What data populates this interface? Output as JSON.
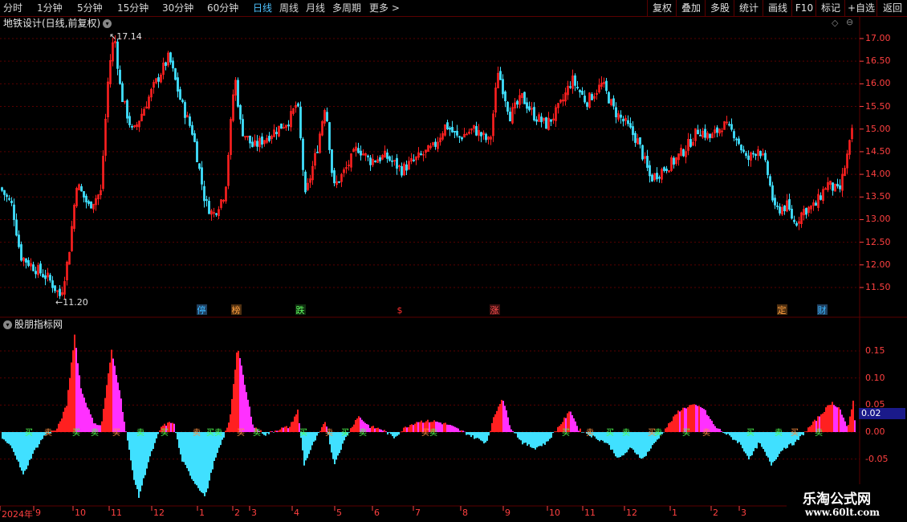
{
  "toolbar": {
    "left_items": [
      "分时",
      "1分钟",
      "5分钟",
      "15分钟",
      "30分钟",
      "60分钟",
      "日线",
      "周线",
      "月线",
      "多周期",
      "更多 >"
    ],
    "active_item": "日线",
    "right_items": [
      "复权",
      "叠加",
      "多股",
      "统计",
      "画线",
      "F10",
      "标记",
      "+自选",
      "返回"
    ]
  },
  "main_panel": {
    "title": "地铁设计(日线,前复权)",
    "high_label": "17.14",
    "low_label": "11.20",
    "price_axis": [
      "17.00",
      "16.50",
      "16.00",
      "15.50",
      "15.00",
      "14.50",
      "14.00",
      "13.50",
      "13.00",
      "12.50",
      "12.00",
      "11.50"
    ],
    "event_markers": [
      {
        "text": "停",
        "color": "#3cb8ff",
        "bg": "#204060"
      },
      {
        "text": "榜",
        "color": "#ffa040",
        "bg": "#503010"
      },
      {
        "text": "跌",
        "color": "#60ff60",
        "bg": "#103010"
      },
      {
        "text": "$",
        "color": "#ff3030",
        "bg": "#000000"
      },
      {
        "text": "涨",
        "color": "#ff5050",
        "bg": "#401010"
      },
      {
        "text": "定",
        "color": "#ffa040",
        "bg": "#503010"
      },
      {
        "text": "财",
        "color": "#3cb8ff",
        "bg": "#204060"
      }
    ]
  },
  "indicator_panel": {
    "title": "股朋指标网",
    "axis": [
      "0.15",
      "0.10",
      "0.05",
      "0.00",
      "-0.05"
    ],
    "current_value": "0.02",
    "signal_buy": "买",
    "signal_sell": "卖"
  },
  "date_axis": [
    "2024年",
    "9",
    "10",
    "11",
    "12",
    "1",
    "2",
    "3",
    "4",
    "5",
    "6",
    "7",
    "8",
    "9",
    "10",
    "11",
    "12",
    "1",
    "2",
    "3"
  ],
  "watermark": {
    "title": "乐淘公式网",
    "url": "www.60lt.com"
  },
  "colors": {
    "up": "#ff2020",
    "down": "#40e0ff",
    "pos_hist": "#ff30ff",
    "neg_hist": "#40e0ff",
    "grid": "#5a0000"
  }
}
